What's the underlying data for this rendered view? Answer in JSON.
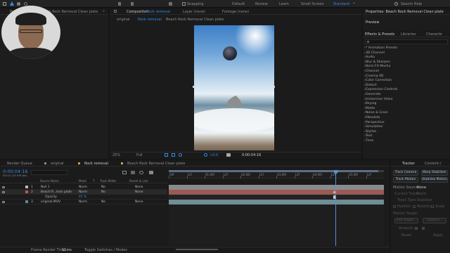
{
  "toolbar": {
    "snapping_label": "Snapping",
    "workspaces": [
      "Default",
      "Review",
      "Learn",
      "Small Screen",
      "Standard"
    ],
    "active_workspace": "Standard",
    "search_label": "Search Help"
  },
  "project_panel": {
    "tab_label": "Project",
    "tab_item": "Beach Rock Removal Clean plate"
  },
  "composition_panel": {
    "tab_prefix": "Composition",
    "tab_comp": "Rock removal",
    "layer_tab": "Layer (none)",
    "footage_tab": "Footage (none)",
    "breadcrumbs": [
      "original",
      "Rock removal",
      "Beach Rock Removal Clean plate"
    ],
    "zoom": "25%",
    "resolution": "Full",
    "exposure": "+0.0",
    "timecode": "0:00:04:16"
  },
  "right_panel": {
    "properties_tab": "Properties: Beach Rock Removal Clean plate",
    "preview_label": "Preview",
    "tabs": [
      "Effects & Presets",
      "Libraries",
      "Characte"
    ],
    "effects": [
      "* Animation Presets",
      "3D Channel",
      "Audio",
      "Blur & Sharpen",
      "Boris FX Mocha",
      "Channel",
      "Cinema 4D",
      "Color Correction",
      "Distort",
      "Expression Controls",
      "Generate",
      "Immersive Video",
      "Keying",
      "Matte",
      "Noise & Grain",
      "Obsolete",
      "Perspective",
      "Simulation",
      "Stylize",
      "Text",
      "Time"
    ]
  },
  "timeline": {
    "tabs": [
      "Render Queue",
      "original",
      "Rock removal",
      "Beach Rock Removal Clean plate"
    ],
    "active_tab_index": 2,
    "current_time": "0:00:04:16",
    "current_time_sub": "00112 (23.976 fps)",
    "columns": [
      "Source Name",
      "Mode",
      "T",
      "Track Matte",
      "Parent & Link"
    ],
    "layers": [
      {
        "num": "1",
        "name": "Null 1",
        "mode": "Norm",
        "matte": "No",
        "parent": "None",
        "color": "#b8b8b8"
      },
      {
        "num": "2",
        "name": "Beach R...lean plate",
        "mode": "Norm",
        "matte": "No",
        "parent": "None",
        "color": "#c7524a"
      },
      {
        "num": "",
        "name": "Opacity",
        "mode": "45 %",
        "matte": "",
        "parent": "",
        "color": ""
      },
      {
        "num": "3",
        "name": "original.MOV",
        "mode": "Norm",
        "matte": "No",
        "parent": "None",
        "color": "#5c8a96"
      }
    ],
    "ruler_labels": [
      "00f",
      "12f",
      "01:00f",
      "12f",
      "02:00f",
      "12f",
      "03:00f",
      "12f",
      "04:00f",
      "12f",
      "05:00f",
      "12f"
    ],
    "playhead_time_fraction": 0.775,
    "footer_render_label": "Frame Render Time",
    "footer_render_value": "11ms",
    "footer_toggle": "Toggle Switches / Modes"
  },
  "tracker_panel": {
    "tabs": [
      "Tracker",
      "Content-/"
    ],
    "buttons": [
      "Track Camera",
      "Warp Stabilizer",
      "Track Motion",
      "Stabilize Motion"
    ],
    "motion_source_label": "Motion Source:",
    "motion_source_value": "None",
    "current_track_label": "Current Track:",
    "current_track_value": "None",
    "track_type_label": "Track Type:",
    "track_type_value": "Stabilize",
    "checks": [
      "Position",
      "Rotation",
      "Scale"
    ],
    "motion_target_label": "Motion Target:",
    "edit_target": "Edit Target...",
    "options": "Options...",
    "analyze_label": "Analyze:",
    "reset": "Reset",
    "apply": "Apply"
  },
  "colors": {
    "accent": "#2d8ceb",
    "panel_bg": "#1d1d1d",
    "playhead": "#5a8fd6"
  }
}
